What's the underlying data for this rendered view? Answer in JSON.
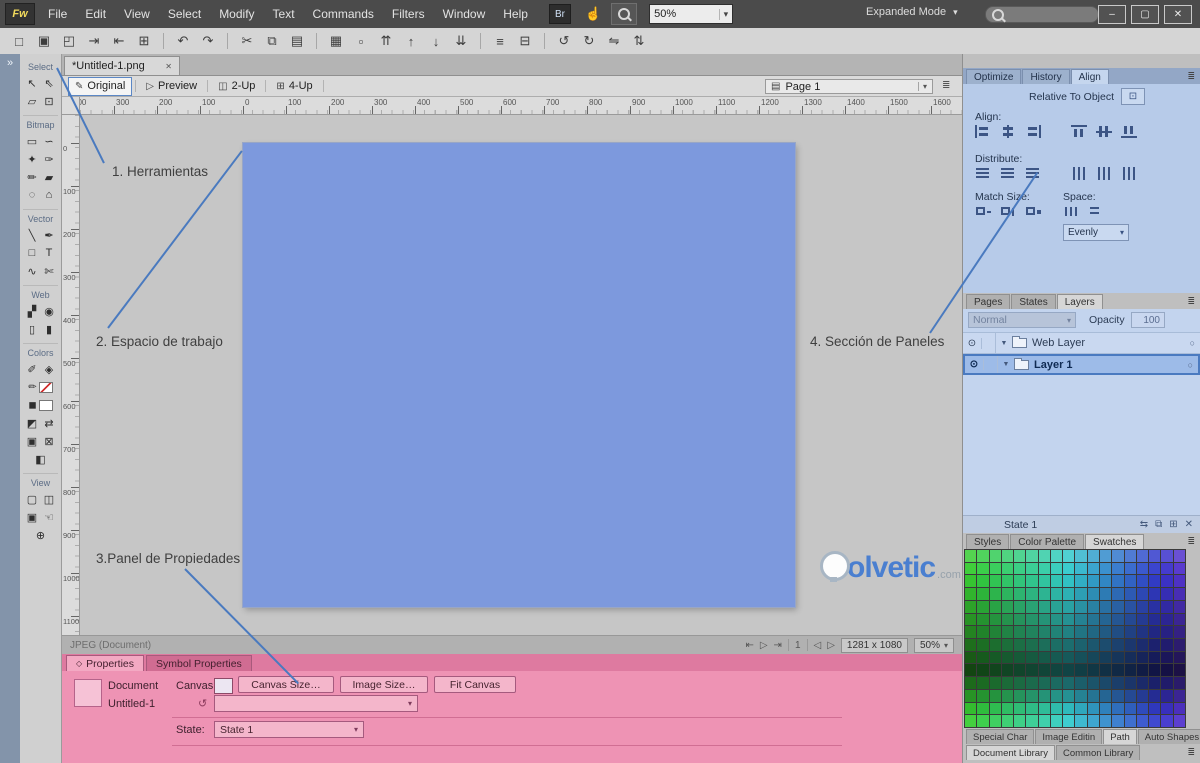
{
  "glyphs": {
    "dropdown": "▾",
    "panel_menu": "≣",
    "collapse": "»"
  },
  "app": {
    "logo_text": "Fw",
    "menus": [
      "File",
      "Edit",
      "View",
      "Select",
      "Modify",
      "Text",
      "Commands",
      "Filters",
      "Window",
      "Help"
    ],
    "bridge_label": "Br",
    "hand_icon": "☝",
    "zoom_percent": "50%",
    "mode_label": "Expanded Mode",
    "search_value": "",
    "win_minimize": "–",
    "win_maximize": "▢",
    "win_close": "✕"
  },
  "toolbar": [
    {
      "name": "new-document-icon",
      "glyph": "□"
    },
    {
      "name": "save-icon",
      "glyph": "▣"
    },
    {
      "name": "open-icon",
      "glyph": "◰"
    },
    {
      "name": "import-icon",
      "glyph": "⇥"
    },
    {
      "name": "export-icon",
      "glyph": "⇤"
    },
    {
      "name": "print-icon",
      "glyph": "⊞"
    },
    {
      "name": "sep"
    },
    {
      "name": "undo-icon",
      "glyph": "↶"
    },
    {
      "name": "redo-icon",
      "glyph": "↷"
    },
    {
      "name": "sep"
    },
    {
      "name": "cut-icon",
      "glyph": "✂"
    },
    {
      "name": "copy-icon",
      "glyph": "⧉"
    },
    {
      "name": "paste-icon",
      "glyph": "▤"
    },
    {
      "name": "sep"
    },
    {
      "name": "group-icon",
      "glyph": "▦"
    },
    {
      "name": "ungroup-icon",
      "glyph": "▫"
    },
    {
      "name": "bring-to-front-icon",
      "glyph": "⇈"
    },
    {
      "name": "bring-forward-icon",
      "glyph": "↑"
    },
    {
      "name": "send-backward-icon",
      "glyph": "↓"
    },
    {
      "name": "send-to-back-icon",
      "glyph": "⇊"
    },
    {
      "name": "sep"
    },
    {
      "name": "align-objects-icon",
      "glyph": "≡"
    },
    {
      "name": "combine-paths-icon",
      "glyph": "⊟"
    },
    {
      "name": "sep"
    },
    {
      "name": "rotate-ccw-icon",
      "glyph": "↺"
    },
    {
      "name": "rotate-cw-icon",
      "glyph": "↻"
    },
    {
      "name": "flip-horizontal-icon",
      "glyph": "⇋"
    },
    {
      "name": "flip-vertical-icon",
      "glyph": "⇅"
    }
  ],
  "tools": {
    "dock_collapse": "»",
    "sections": [
      {
        "label": "Select",
        "tools": [
          {
            "name": "pointer-tool",
            "glyph": "↖"
          },
          {
            "name": "subselection-tool",
            "glyph": "⇖"
          },
          {
            "name": "scale-tool",
            "glyph": "▱"
          },
          {
            "name": "crop-tool",
            "glyph": "⊡"
          }
        ]
      },
      {
        "label": "Bitmap",
        "tools": [
          {
            "name": "marquee-tool",
            "glyph": "▭"
          },
          {
            "name": "lasso-tool",
            "glyph": "∽"
          },
          {
            "name": "magic-wand-tool",
            "glyph": "✦"
          },
          {
            "name": "brush-tool",
            "glyph": "✑"
          },
          {
            "name": "pencil-tool",
            "glyph": "✏"
          },
          {
            "name": "eraser-tool",
            "glyph": "▰"
          },
          {
            "name": "blur-tool",
            "glyph": "◌"
          },
          {
            "name": "rubber-stamp-tool",
            "glyph": "⌂"
          }
        ]
      },
      {
        "label": "Vector",
        "tools": [
          {
            "name": "line-tool",
            "glyph": "╲"
          },
          {
            "name": "pen-tool",
            "glyph": "✒"
          },
          {
            "name": "rectangle-tool",
            "glyph": "□"
          },
          {
            "name": "text-tool",
            "glyph": "T"
          },
          {
            "name": "freeform-tool",
            "glyph": "∿"
          },
          {
            "name": "knife-tool",
            "glyph": "✄"
          }
        ]
      },
      {
        "label": "Web",
        "tools": [
          {
            "name": "slice-tool",
            "glyph": "▞"
          },
          {
            "name": "hotspot-tool",
            "glyph": "◉"
          },
          {
            "name": "hide-slices-button",
            "glyph": "▯"
          },
          {
            "name": "show-slices-button",
            "glyph": "▮"
          }
        ]
      },
      {
        "label": "Colors",
        "tools": [
          {
            "name": "eyedropper-tool",
            "glyph": "✐"
          },
          {
            "name": "paint-bucket-tool",
            "glyph": "◈"
          },
          {
            "name": "stroke-color-well",
            "glyph": "✏",
            "swatch": "stroke"
          },
          {
            "name": "fill-color-well",
            "glyph": "◼",
            "swatch": "fill"
          },
          {
            "name": "default-colors-button",
            "glyph": "◩"
          },
          {
            "name": "swap-colors-button",
            "glyph": "⇄"
          },
          {
            "name": "stroke-toggle",
            "glyph": "▣"
          },
          {
            "name": "no-color-toggle",
            "glyph": "⊠"
          },
          {
            "name": "fill-toggle",
            "glyph": "◧"
          }
        ]
      },
      {
        "label": "View",
        "tools": [
          {
            "name": "standard-screen-button",
            "glyph": "▢"
          },
          {
            "name": "full-screen-menus-button",
            "glyph": "◫"
          },
          {
            "name": "full-screen-button",
            "glyph": "▣"
          },
          {
            "name": "hand-tool",
            "glyph": "☜"
          },
          {
            "name": "zoom-tool",
            "glyph": "⊕"
          }
        ]
      }
    ]
  },
  "document": {
    "tab_title": "*Untitled-1.png",
    "tab_close": "✕",
    "views": [
      {
        "label": "Original",
        "icon": "✎",
        "active": true
      },
      {
        "label": "Preview",
        "icon": "▷"
      },
      {
        "label": "2-Up",
        "icon": "◫"
      },
      {
        "label": "4-Up",
        "icon": "⊞"
      }
    ],
    "page_icon": "▤",
    "page_label": "Page 1",
    "status_format": "JPEG (Document)",
    "nav": {
      "first": "⇤",
      "play": "▷",
      "last": "⇥",
      "frame": "1",
      "prev": "◁",
      "next": "▷"
    },
    "size_readout": "1281 x 1080",
    "zoom_readout": "50%"
  },
  "rulers": {
    "h": {
      "origin": 163,
      "step": 43,
      "from": -4,
      "to": 16
    },
    "v": {
      "origin": 28,
      "step": 43,
      "from": 0,
      "to": 11
    }
  },
  "annotations": {
    "label1": "1. Herramientas",
    "label2": "2. Espacio de trabajo",
    "label3": "3.Panel de Propiedades",
    "label4": "4. Sección de Paneles",
    "watermark_text": "olvetic",
    "watermark_suffix": ".com"
  },
  "panels": {
    "align": {
      "tabs": [
        {
          "label": "Optimize"
        },
        {
          "label": "History"
        },
        {
          "label": "Align",
          "active": true
        }
      ],
      "relative_label": "Relative To Object",
      "relative_icon": "⊡",
      "align_label": "Align:",
      "align_icons": [
        {
          "name": "align-left-icon",
          "cls": "al-l"
        },
        {
          "name": "align-center-vertical-icon",
          "cls": "al-c"
        },
        {
          "name": "align-right-icon",
          "cls": "al-r"
        },
        {
          "name": "align-top-icon",
          "cls": "al-t"
        },
        {
          "name": "align-middle-icon",
          "cls": "al-m"
        },
        {
          "name": "align-bottom-icon",
          "cls": "al-b"
        }
      ],
      "distribute_label": "Distribute:",
      "distribute_icons": [
        {
          "name": "distribute-top-icon",
          "cls": "di-h"
        },
        {
          "name": "distribute-middle-icon",
          "cls": "di-h"
        },
        {
          "name": "distribute-bottom-icon",
          "cls": "di-h"
        },
        {
          "name": "distribute-left-icon",
          "cls": "di-v"
        },
        {
          "name": "distribute-center-icon",
          "cls": "di-v"
        },
        {
          "name": "distribute-right-icon",
          "cls": "di-v"
        }
      ],
      "match_label": "Match Size:",
      "match_icons": [
        {
          "name": "match-width-icon",
          "cls": "ma-w"
        },
        {
          "name": "match-height-icon",
          "cls": "ma-h"
        },
        {
          "name": "match-both-icon",
          "cls": "ma-b"
        }
      ],
      "space_label": "Space:",
      "space_icons": [
        {
          "name": "space-horizontal-icon",
          "cls": "sp-h"
        },
        {
          "name": "space-vertical-icon",
          "cls": "sp-v"
        }
      ],
      "evenly_value": "Evenly"
    },
    "layers": {
      "tabs": [
        {
          "label": "Pages"
        },
        {
          "label": "States"
        },
        {
          "label": "Layers",
          "active": true
        }
      ],
      "blend_value": "Normal",
      "opacity_label": "Opacity",
      "opacity_value": "100",
      "row_right_icon": "○",
      "rows": [
        {
          "name": "Web Layer",
          "selected": false,
          "eye": "⊙",
          "expand": "▼"
        },
        {
          "name": "Layer 1",
          "selected": true,
          "eye": "⊙",
          "expand": "▼"
        }
      ],
      "footer_label": "State 1",
      "footer_icons": [
        {
          "name": "onion-skin-icon",
          "glyph": "⇆"
        },
        {
          "name": "duplicate-state-icon",
          "glyph": "⧉"
        },
        {
          "name": "new-layer-icon",
          "glyph": "⊞"
        },
        {
          "name": "delete-layer-icon",
          "glyph": "✕"
        }
      ]
    },
    "swatches": {
      "tabs": [
        {
          "label": "Styles"
        },
        {
          "label": "Color Palette"
        },
        {
          "label": "Swatches",
          "active": true
        }
      ],
      "grid": {
        "rows": 14,
        "cols": 18,
        "hue_start": 118,
        "hue_end": 252,
        "saturation": 60,
        "row_lightness": [
          57,
          52,
          48,
          44,
          40,
          36,
          32,
          27,
          22,
          17,
          26,
          36,
          46,
          53
        ]
      }
    },
    "bottom_tabs_row1": [
      {
        "label": "Special Char"
      },
      {
        "label": "Image Editin"
      },
      {
        "label": "Path",
        "active": true
      },
      {
        "label": "Auto Shapes"
      }
    ],
    "bottom_tabs_row2": [
      {
        "label": "Document Library",
        "active": true
      },
      {
        "label": "Common Library"
      }
    ]
  },
  "properties": {
    "tabs": [
      {
        "label": "Properties",
        "active": true
      },
      {
        "label": "Symbol Properties"
      }
    ],
    "tab_bullet": "◇",
    "doc_type_label": "Document",
    "doc_name": "Untitled-1",
    "canvas_label": "Canvas:",
    "canvas_size_button": "Canvas Size…",
    "image_size_button": "Image Size…",
    "fit_canvas_button": "Fit Canvas",
    "reset_icon": "↺",
    "state_label": "State:",
    "state_value": "State 1"
  },
  "colors": {
    "canvas_fill": "#7d99dd",
    "annotation_line": "#4a7abf",
    "highlight_blue": "#b7cbe9",
    "highlight_pink": "#ee93b4"
  }
}
